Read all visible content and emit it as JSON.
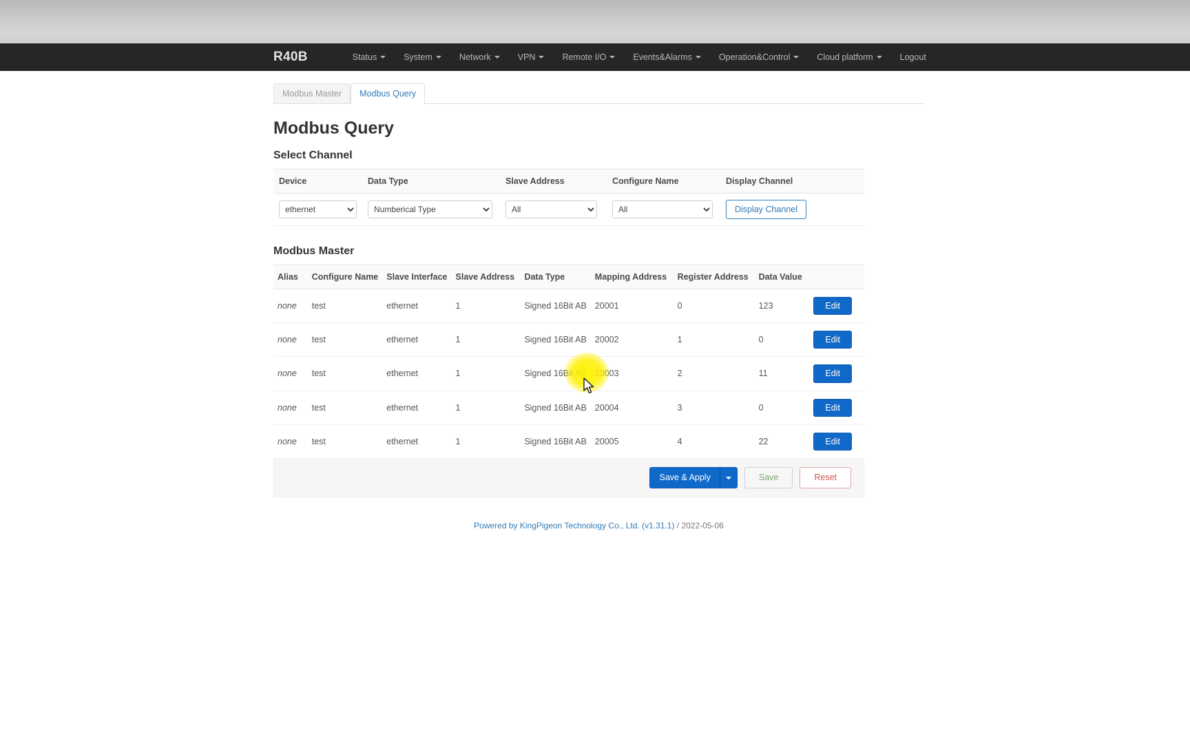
{
  "navbar": {
    "brand": "R40B",
    "items": [
      {
        "label": "Status",
        "has_caret": true
      },
      {
        "label": "System",
        "has_caret": true
      },
      {
        "label": "Network",
        "has_caret": true
      },
      {
        "label": "VPN",
        "has_caret": true
      },
      {
        "label": "Remote I/O",
        "has_caret": true
      },
      {
        "label": "Events&Alarms",
        "has_caret": true
      },
      {
        "label": "Operation&Control",
        "has_caret": true
      },
      {
        "label": "Cloud platform",
        "has_caret": true
      },
      {
        "label": "Logout",
        "has_caret": false
      }
    ]
  },
  "tabs": [
    {
      "label": "Modbus Master",
      "active": false
    },
    {
      "label": "Modbus Query",
      "active": true
    }
  ],
  "page_title": "Modbus Query",
  "select_channel": {
    "heading": "Select Channel",
    "headers": [
      "Device",
      "Data Type",
      "Slave Address",
      "Configure Name",
      "Display Channel"
    ],
    "device": {
      "value": "ethernet",
      "options": [
        "ethernet"
      ]
    },
    "data_type": {
      "value": "Numberical Type",
      "options": [
        "Numberical Type"
      ]
    },
    "slave_address": {
      "value": "All",
      "options": [
        "All"
      ]
    },
    "configure_name": {
      "value": "All",
      "options": [
        "All"
      ]
    },
    "display_button": "Display Channel"
  },
  "modbus_master": {
    "heading": "Modbus Master",
    "headers": [
      "Alias",
      "Configure Name",
      "Slave Interface",
      "Slave Address",
      "Data Type",
      "Mapping Address",
      "Register Address",
      "Data Value"
    ],
    "edit_label": "Edit",
    "rows": [
      {
        "alias": "none",
        "configure_name": "test",
        "slave_interface": "ethernet",
        "slave_address": "1",
        "data_type": "Signed 16Bit AB",
        "mapping_address": "20001",
        "register_address": "0",
        "data_value": "123"
      },
      {
        "alias": "none",
        "configure_name": "test",
        "slave_interface": "ethernet",
        "slave_address": "1",
        "data_type": "Signed 16Bit AB",
        "mapping_address": "20002",
        "register_address": "1",
        "data_value": "0"
      },
      {
        "alias": "none",
        "configure_name": "test",
        "slave_interface": "ethernet",
        "slave_address": "1",
        "data_type": "Signed 16Bit AB",
        "mapping_address": "20003",
        "register_address": "2",
        "data_value": "11"
      },
      {
        "alias": "none",
        "configure_name": "test",
        "slave_interface": "ethernet",
        "slave_address": "1",
        "data_type": "Signed 16Bit AB",
        "mapping_address": "20004",
        "register_address": "3",
        "data_value": "0"
      },
      {
        "alias": "none",
        "configure_name": "test",
        "slave_interface": "ethernet",
        "slave_address": "1",
        "data_type": "Signed 16Bit AB",
        "mapping_address": "20005",
        "register_address": "4",
        "data_value": "22"
      }
    ]
  },
  "actions": {
    "save_apply": "Save & Apply",
    "save": "Save",
    "reset": "Reset"
  },
  "footer": {
    "link_text": "Powered by KingPigeon Technology Co., Ltd. (v1.31.1)",
    "suffix": " / 2022-05-06"
  },
  "colors": {
    "navbar_bg": "#262626",
    "primary_blue": "#1068c9",
    "link_blue": "#337ab7",
    "reset_red": "#c9584f",
    "save_green": "#7aa86f",
    "highlight_yellow": "#fff200"
  }
}
